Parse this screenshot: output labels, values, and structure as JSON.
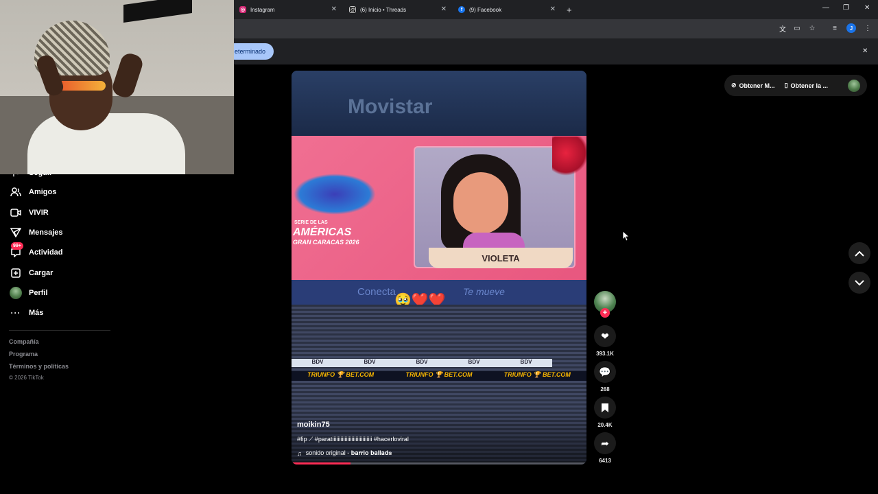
{
  "browser": {
    "tabs": [
      {
        "title": "Instagram",
        "icon": "instagram-icon",
        "color": "#e1306c"
      },
      {
        "title": "(6) Inicio • Threads",
        "icon": "threads-icon",
        "color": "#ffffff"
      },
      {
        "title": "(9) Facebook",
        "icon": "facebook-icon",
        "color": "#1877f2"
      }
    ],
    "new_tab": "+",
    "infobar_button": "eterminado",
    "infobar_close": "✕"
  },
  "sidebar": {
    "partial_item": "Seguir",
    "items": [
      {
        "label": "Amigos",
        "icon": "friends-icon"
      },
      {
        "label": "VIVIR",
        "icon": "live-icon"
      },
      {
        "label": "Mensajes",
        "icon": "messages-icon"
      },
      {
        "label": "Actividad",
        "icon": "activity-icon",
        "badge": "99+"
      },
      {
        "label": "Cargar",
        "icon": "upload-icon"
      },
      {
        "label": "Perfil",
        "icon": "avatar"
      },
      {
        "label": "Más",
        "icon": "more-icon"
      }
    ],
    "footer": [
      "Compañía",
      "Programa",
      "Términos y políticas",
      "© 2026 TikTok"
    ]
  },
  "video": {
    "banner_brand": "Movistar",
    "event_line1": "SERIE DE LAS",
    "event_line2": "AMÉRICAS",
    "event_line3": "GRAN CARACAS 2026",
    "character_name": "VIOLETA",
    "ribbon_text": "Conecta",
    "ribbon_script": "Te mueve",
    "emojis": "🥹❤️❤️",
    "ad_tags": [
      "BDV",
      "BDV",
      "BDV",
      "BDV",
      "BDV"
    ],
    "ad_strip": [
      "TRIUNFO 🏆 BET.COM",
      "TRIUNFO 🏆 BET.COM",
      "TRIUNFO 🏆 BET.COM"
    ],
    "username": "moikin75",
    "caption": "#fip ⟋ #paratiiiiiiiiiiiiiiiiiiiiiiiiiiiii #hacerloviral",
    "sound": "sonido original - 𝐛𝐚𝐫𝐫𝐢𝐨 𝐛𝐚𝐥𝐥𝐚𝐝𝐬",
    "progress": 0.2
  },
  "actions": {
    "likes": "393.1K",
    "comments": "268",
    "saves": "20.4K",
    "shares": "6413"
  },
  "topright": {
    "get_app1": "Obtener M...",
    "get_app2": "Obtener la ..."
  }
}
